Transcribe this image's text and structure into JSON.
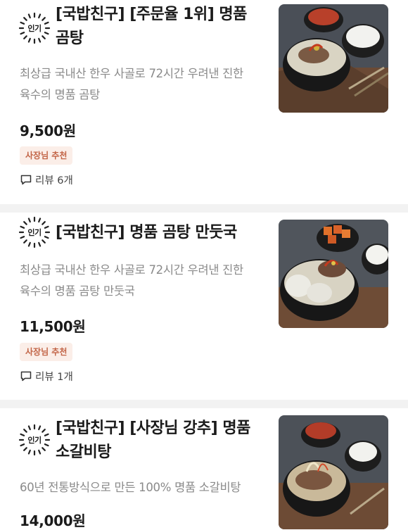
{
  "menu": {
    "items": [
      {
        "badge": "인기",
        "name_line1": "[국밥친구] [주문율 1위] 명품",
        "name_line2": "곰탕",
        "desc_line1": "최상급 국내산 한우 사골로 72시간 우려낸 진한",
        "desc_line2": "육수의 명품 곰탕",
        "price": "9,500원",
        "tag": "사장님 추천",
        "review": "리뷰 6개"
      },
      {
        "badge": "인기",
        "name_line1": "[국밥친구] 명품 곰탕 만둣국",
        "desc_line1": "최상급 국내산 한우 사골로 72시간 우려낸 진한",
        "desc_line2": "육수의 명품 곰탕 만둣국",
        "price": "11,500원",
        "tag": "사장님 추천",
        "review": "리뷰 1개"
      },
      {
        "badge": "인기",
        "name_line1": "[국밥친구] [사장님 강추] 명품",
        "name_line2": "소갈비탕",
        "desc_line1": "60년 전통방식으로 만든 100% 명품 소갈비탕",
        "price": "14,000원"
      }
    ]
  },
  "colors": {
    "tag_background": "#fbeee8",
    "tag_text": "#c26446",
    "divider": "#f2f2f2",
    "description_text": "#8a8a8a"
  },
  "icons": {
    "badge": "popular-sunburst-icon",
    "review": "speech-bubble-icon"
  }
}
